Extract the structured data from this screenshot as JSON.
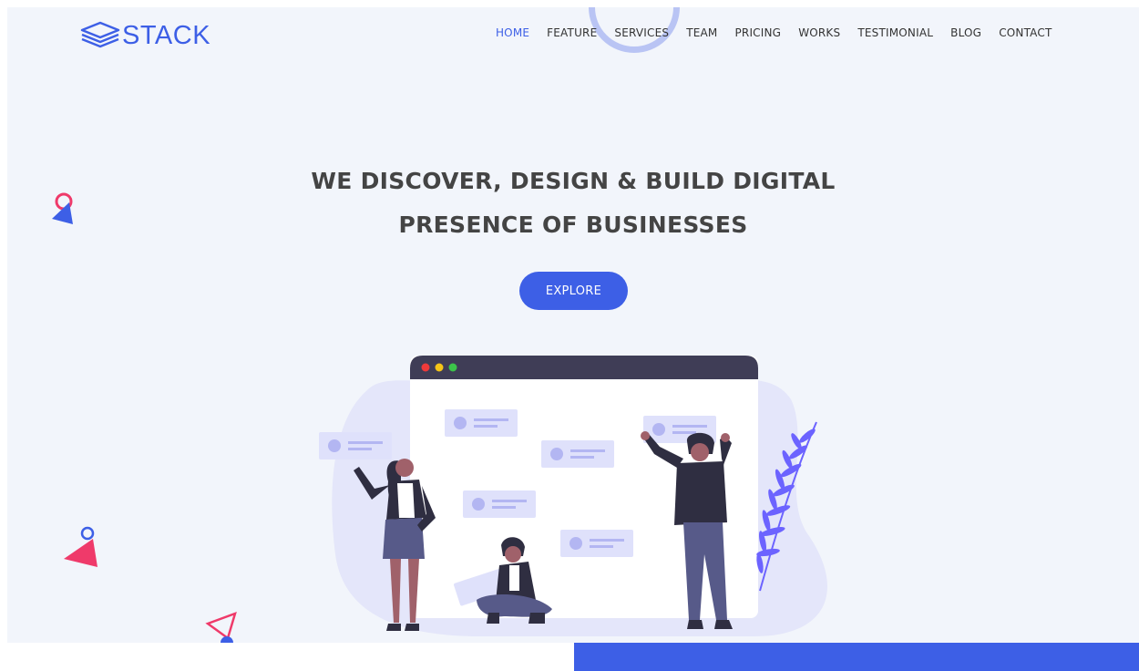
{
  "brand": {
    "name": "STACK",
    "icon": "layers-icon",
    "color": "#3d5fe6"
  },
  "nav": {
    "items": [
      {
        "label": "HOME",
        "active": true
      },
      {
        "label": "FEATURE"
      },
      {
        "label": "SERVICES"
      },
      {
        "label": "TEAM"
      },
      {
        "label": "PRICING"
      },
      {
        "label": "WORKS"
      },
      {
        "label": "TESTIMONIAL"
      },
      {
        "label": "BLOG"
      },
      {
        "label": "CONTACT"
      }
    ]
  },
  "hero": {
    "headline_line1": "WE DISCOVER, DESIGN & BUILD DIGITAL",
    "headline_line2": "PRESENCE OF BUSINESSES",
    "cta_label": "EXPLORE"
  },
  "colors": {
    "accent": "#3d5fe6",
    "background": "#f2f5fb",
    "shape_pink": "#ef3a6a",
    "browser_bar": "#3f3d56"
  }
}
